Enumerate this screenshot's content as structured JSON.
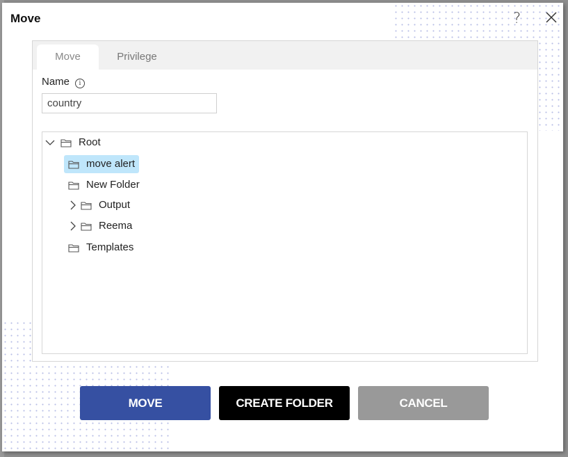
{
  "dialog": {
    "title": "Move",
    "help_icon": "question-mark-icon",
    "close_icon": "close-x-icon"
  },
  "tabs": [
    {
      "label": "Move",
      "active": true
    },
    {
      "label": "Privilege",
      "active": false
    }
  ],
  "name_field": {
    "label": "Name",
    "info_icon": "info-icon",
    "value": "country"
  },
  "tree": {
    "root": {
      "label": "Root",
      "expanded": true
    },
    "items": [
      {
        "label": "move alert",
        "selected": true,
        "expandable": false
      },
      {
        "label": "New Folder",
        "selected": false,
        "expandable": false
      },
      {
        "label": "Output",
        "selected": false,
        "expandable": true
      },
      {
        "label": "Reema",
        "selected": false,
        "expandable": true
      },
      {
        "label": "Templates",
        "selected": false,
        "expandable": false
      }
    ]
  },
  "buttons": {
    "move": "MOVE",
    "create_folder": "CREATE FOLDER",
    "cancel": "CANCEL"
  },
  "colors": {
    "move_button": "#3650a2",
    "create_button": "#000000",
    "cancel_button": "#999999",
    "selected_item": "#bfe6fb"
  }
}
